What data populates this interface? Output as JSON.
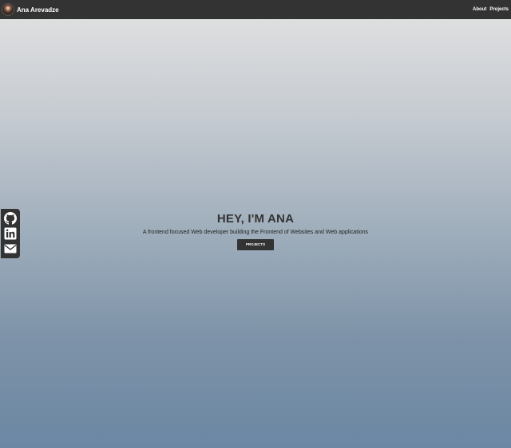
{
  "navbar": {
    "brand_name": "Ana Arevadze",
    "links": [
      "About",
      "Projects"
    ]
  },
  "social": {
    "icons": [
      "github-icon",
      "linkedin-icon",
      "email-icon"
    ]
  },
  "hero": {
    "title": "HEY, I'M ANA",
    "subtitle": "A frontend focused Web developer building the Frontend of Websites and Web applications",
    "button_label": "PROJECTS"
  },
  "colors": {
    "navbar_bg": "#333333",
    "gradient_top": "#e2e2e2",
    "gradient_bottom": "#6b87a3",
    "button_bg": "#333333",
    "text_dark": "#333333"
  }
}
